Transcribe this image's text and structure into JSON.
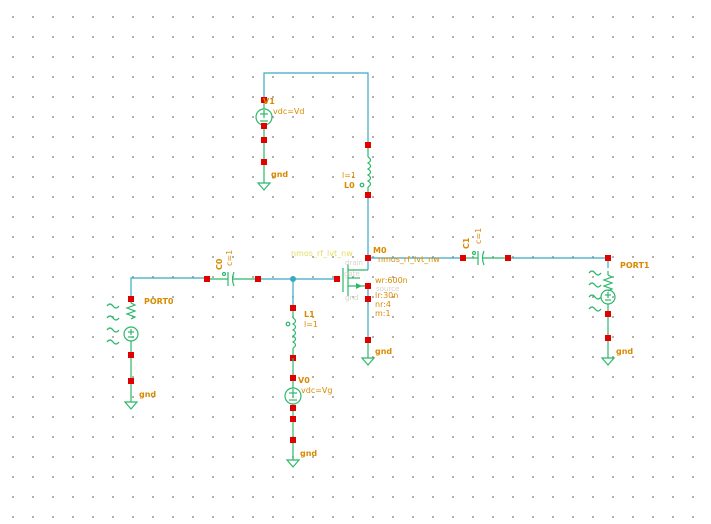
{
  "instances": {
    "v1": {
      "name": "V1",
      "param": "vdc=Vd"
    },
    "v0": {
      "name": "V0",
      "param": "vdc=Vg"
    },
    "l0": {
      "name": "L0",
      "param": "l=1"
    },
    "l1": {
      "name": "L1",
      "param": "l=1"
    },
    "c0": {
      "name": "C0",
      "param": "c=1"
    },
    "c1": {
      "name": "C1",
      "param": "c=1"
    },
    "port0": {
      "name": "PORT0"
    },
    "port1": {
      "name": "PORT1"
    },
    "m0": {
      "name": "M0",
      "model": "nmos_rf_lvt_nw",
      "cell_label": "nmos_rf_lvt_nw",
      "params": [
        "wr:600n",
        "lr:30n",
        "nr:4",
        "m:1"
      ],
      "pins": [
        "drain",
        "gate",
        "source",
        "gnd"
      ]
    }
  },
  "ground_label": "gnd",
  "colors": {
    "wire": "#3aa9c4",
    "device": "#2bb86a",
    "pin": "#e00000",
    "label": "#d98a00",
    "grid_dot": "#9a9a9a"
  }
}
